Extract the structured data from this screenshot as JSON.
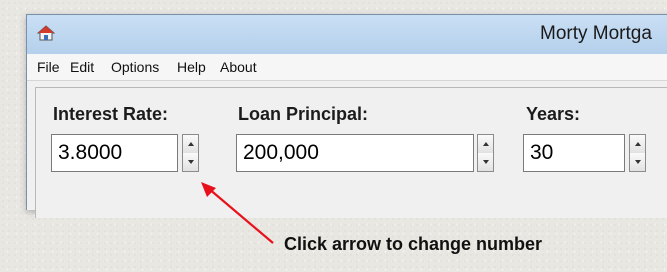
{
  "window": {
    "title": "Morty Mortga",
    "icon": "house-icon"
  },
  "menu": [
    "File",
    "Edit",
    "Options",
    "Help",
    "About"
  ],
  "fields": {
    "interest_rate": {
      "label": "Interest Rate:",
      "value": "3.8000"
    },
    "loan_principal": {
      "label": "Loan Principal:",
      "value": "200,000"
    },
    "years": {
      "label": "Years:",
      "value": "30"
    }
  },
  "annotation": {
    "text": "Click arrow to change number",
    "arrow_color": "#e8101a"
  },
  "colors": {
    "titlebar": "#c3daf2",
    "window_bg": "#f0f0f0"
  }
}
